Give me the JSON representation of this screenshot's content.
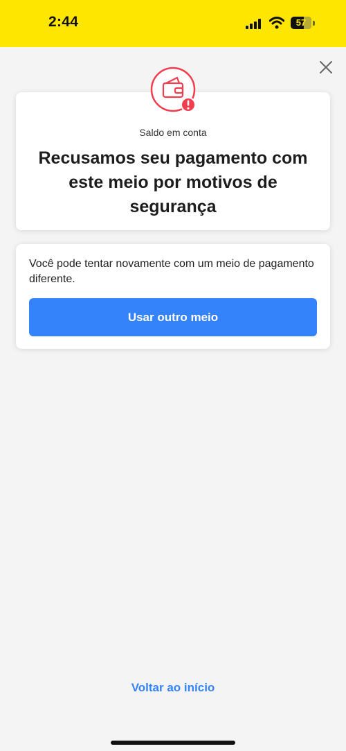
{
  "status_bar": {
    "time": "2:44",
    "battery_level": "57",
    "background_color": "#ffe600"
  },
  "header": {
    "close_icon": "close-icon"
  },
  "main_card": {
    "account_label": "Saldo em conta",
    "title": "Recusamos seu pagamento com este meio por motivos de segurança",
    "icon": "wallet-alert-icon",
    "accent_color": "#f23d4f"
  },
  "retry_card": {
    "text": "Você pode tentar novamente com um meio de pagamento diferente.",
    "button_label": "Usar outro meio",
    "button_color": "#3483fa"
  },
  "footer": {
    "back_link": "Voltar ao início"
  }
}
